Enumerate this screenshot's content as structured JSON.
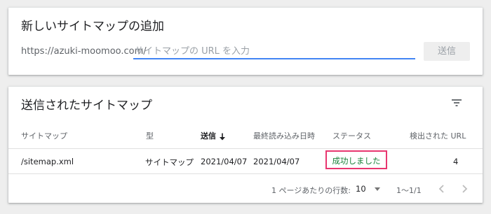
{
  "add_sitemap": {
    "title": "新しいサイトマップの追加",
    "url_prefix": "https://azuki-moomoo.com/",
    "input_value": "",
    "input_placeholder": "サイトマップの URL を入力",
    "submit_label": "送信"
  },
  "submitted": {
    "title": "送信されたサイトマップ",
    "filter_icon": "filter-icon",
    "columns": {
      "sitemap": "サイトマップ",
      "type": "型",
      "submitted": "送信",
      "last_read": "最終読み込み日時",
      "status": "ステータス",
      "discovered_urls": "検出された URL"
    },
    "sort_icon": "arrow-down-icon",
    "rows": [
      {
        "sitemap": "/sitemap.xml",
        "type": "サイトマップ",
        "submitted": "2021/04/07",
        "last_read": "2021/04/07",
        "status": "成功しました",
        "discovered_urls": "4"
      }
    ],
    "pagination": {
      "rows_per_page_label": "1 ページあたりの行数:",
      "rows_per_page": "10",
      "range": "1〜1/1"
    }
  },
  "colors": {
    "status_success": "#188038",
    "highlight_border": "#e8366f",
    "input_focus": "#4285f4"
  }
}
